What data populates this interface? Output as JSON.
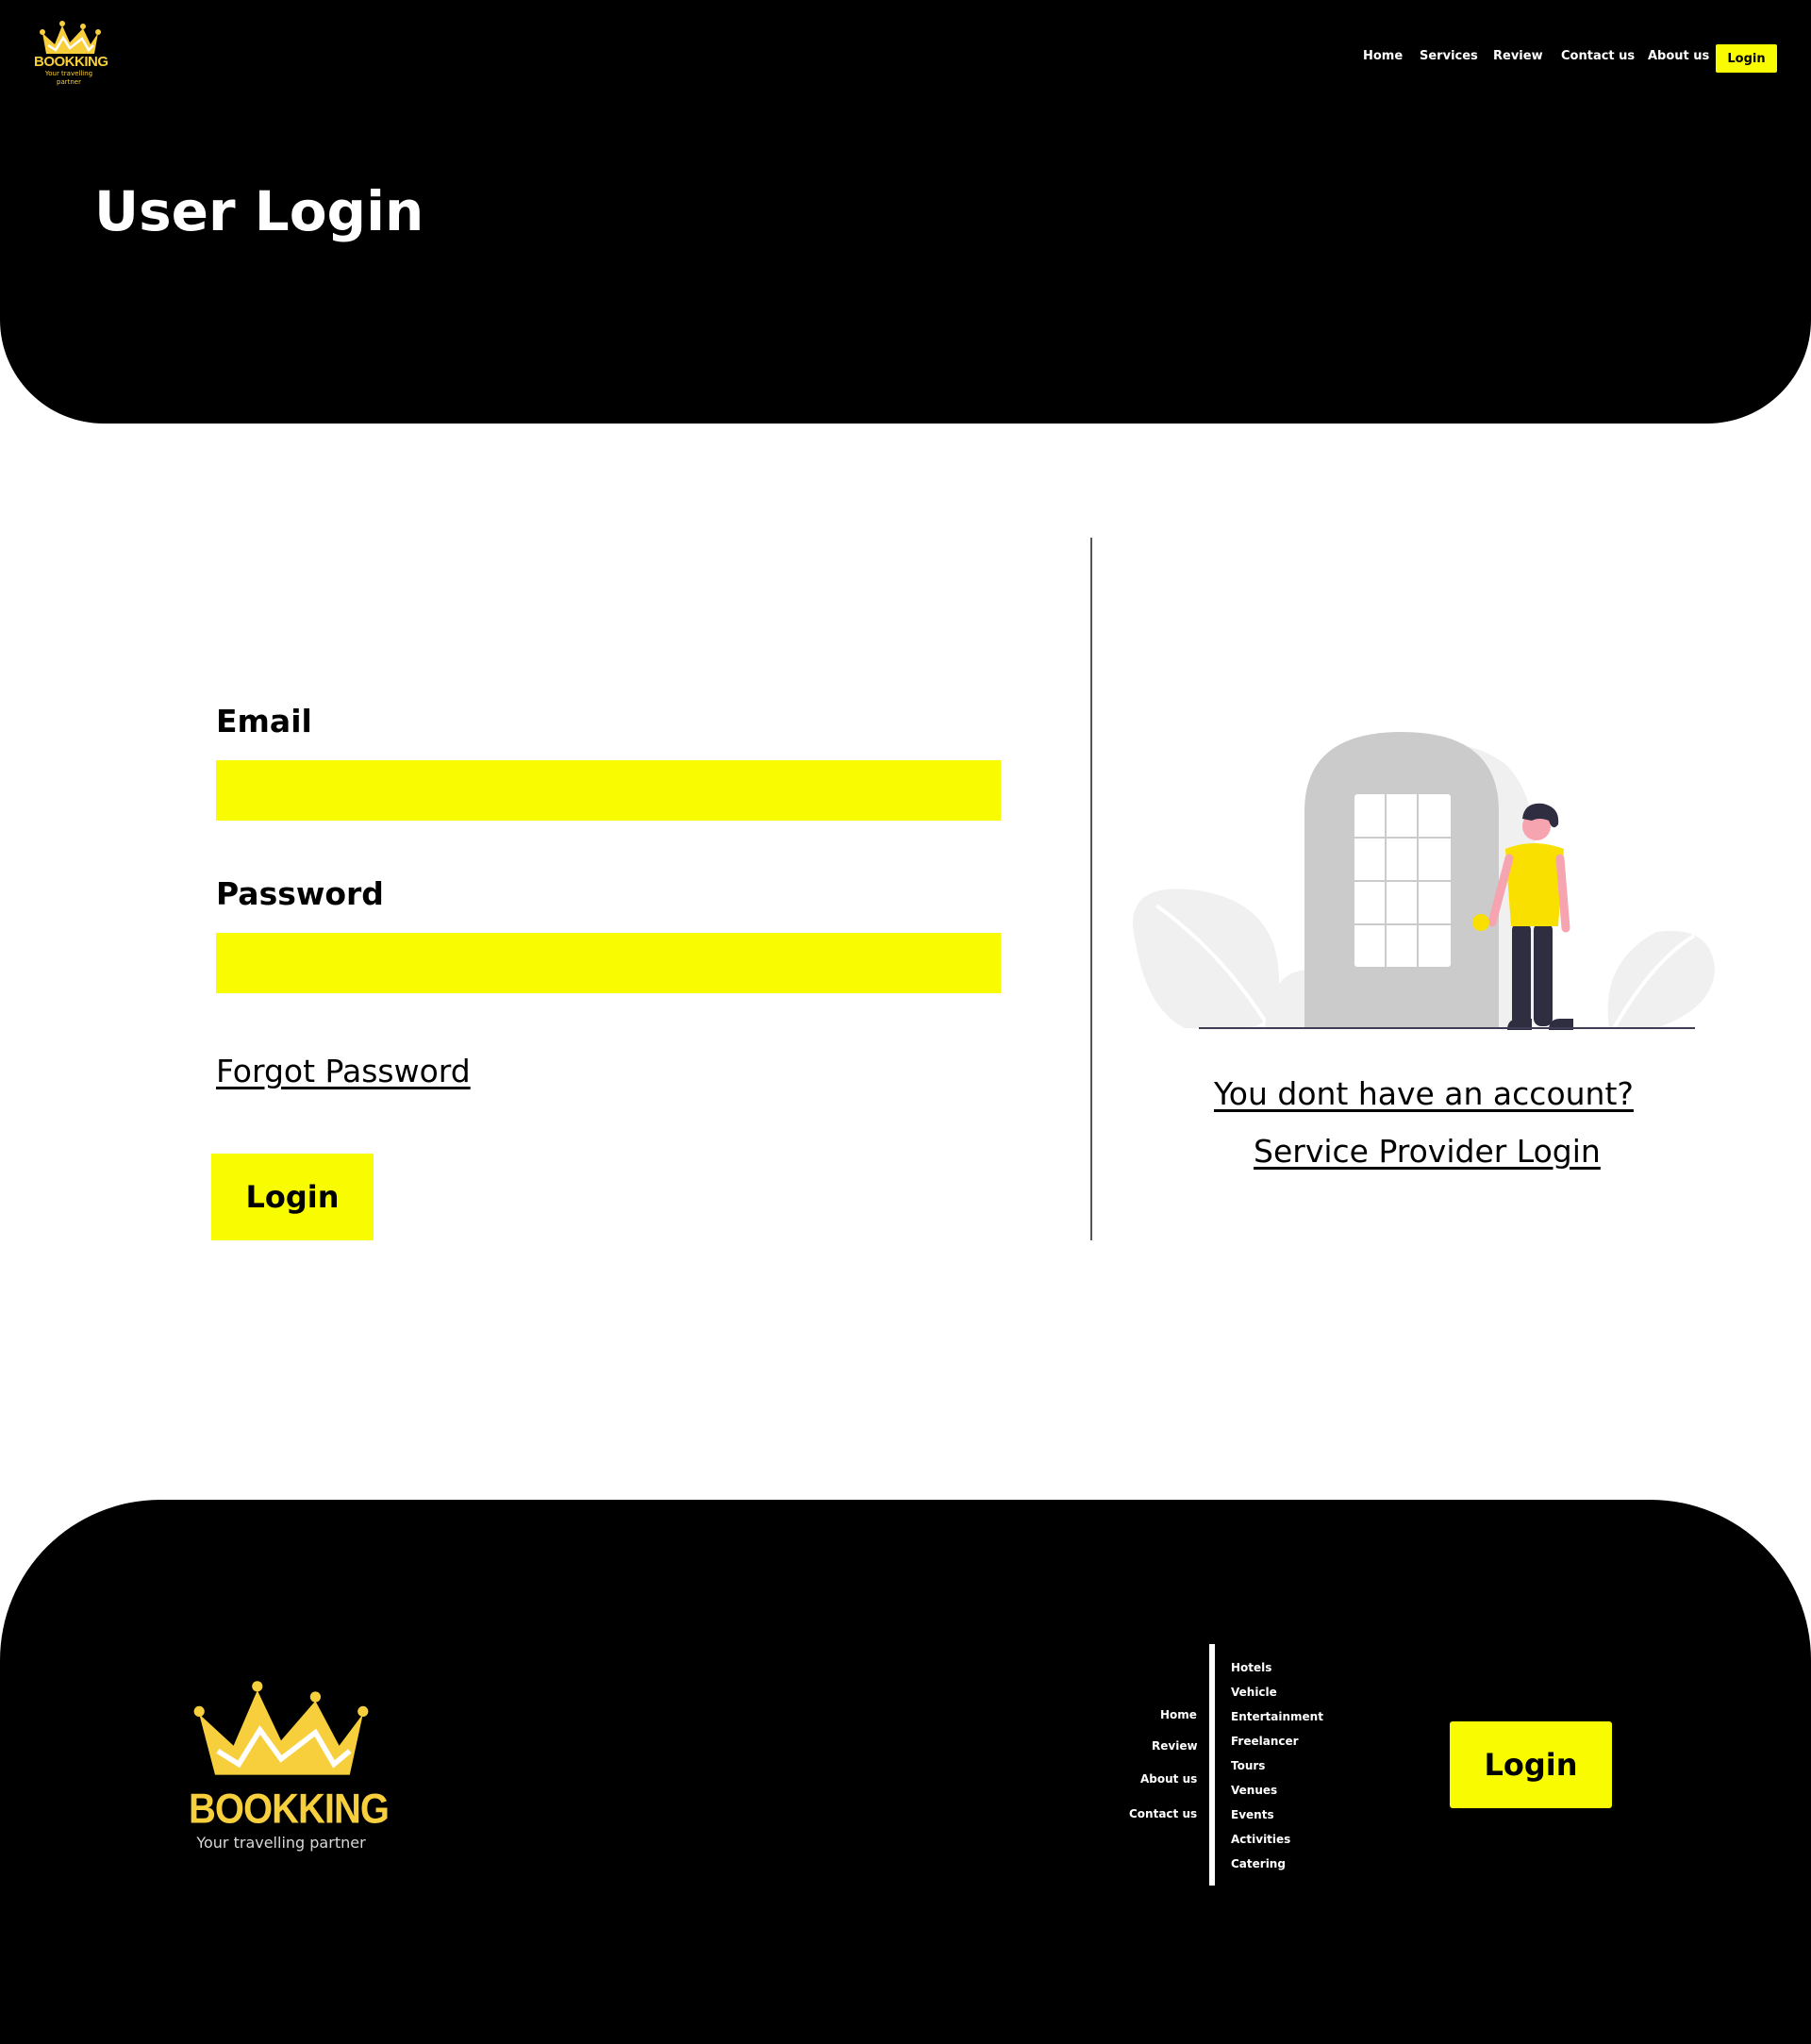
{
  "header": {
    "brand": "BOOKKING",
    "tagline": "Your travelling partner",
    "nav": [
      "Home",
      "Services",
      "Review",
      "Contact us",
      "About us"
    ],
    "login_label": "Login",
    "page_title": "User Login"
  },
  "form": {
    "email_label": "Email",
    "email_value": "",
    "password_label": "Password",
    "password_value": "",
    "forgot_label": "Forgot Password",
    "login_label": "Login"
  },
  "side": {
    "signup_link": "You dont have an account?",
    "provider_link": "Service Provider Login"
  },
  "footer": {
    "brand": "BOOKKING",
    "tagline": "Your travelling partner",
    "nav": [
      "Home",
      "Review",
      "About us",
      "Contact us"
    ],
    "services": [
      "Hotels",
      "Vehicle",
      "Entertainment",
      "Freelancer",
      "Tours",
      "Venues",
      "Events",
      "Activities",
      "Catering"
    ],
    "login_label": "Login"
  },
  "colors": {
    "accent": "#f9fc00",
    "logo_gold": "#f7cf3c",
    "background_dark": "#000000"
  }
}
